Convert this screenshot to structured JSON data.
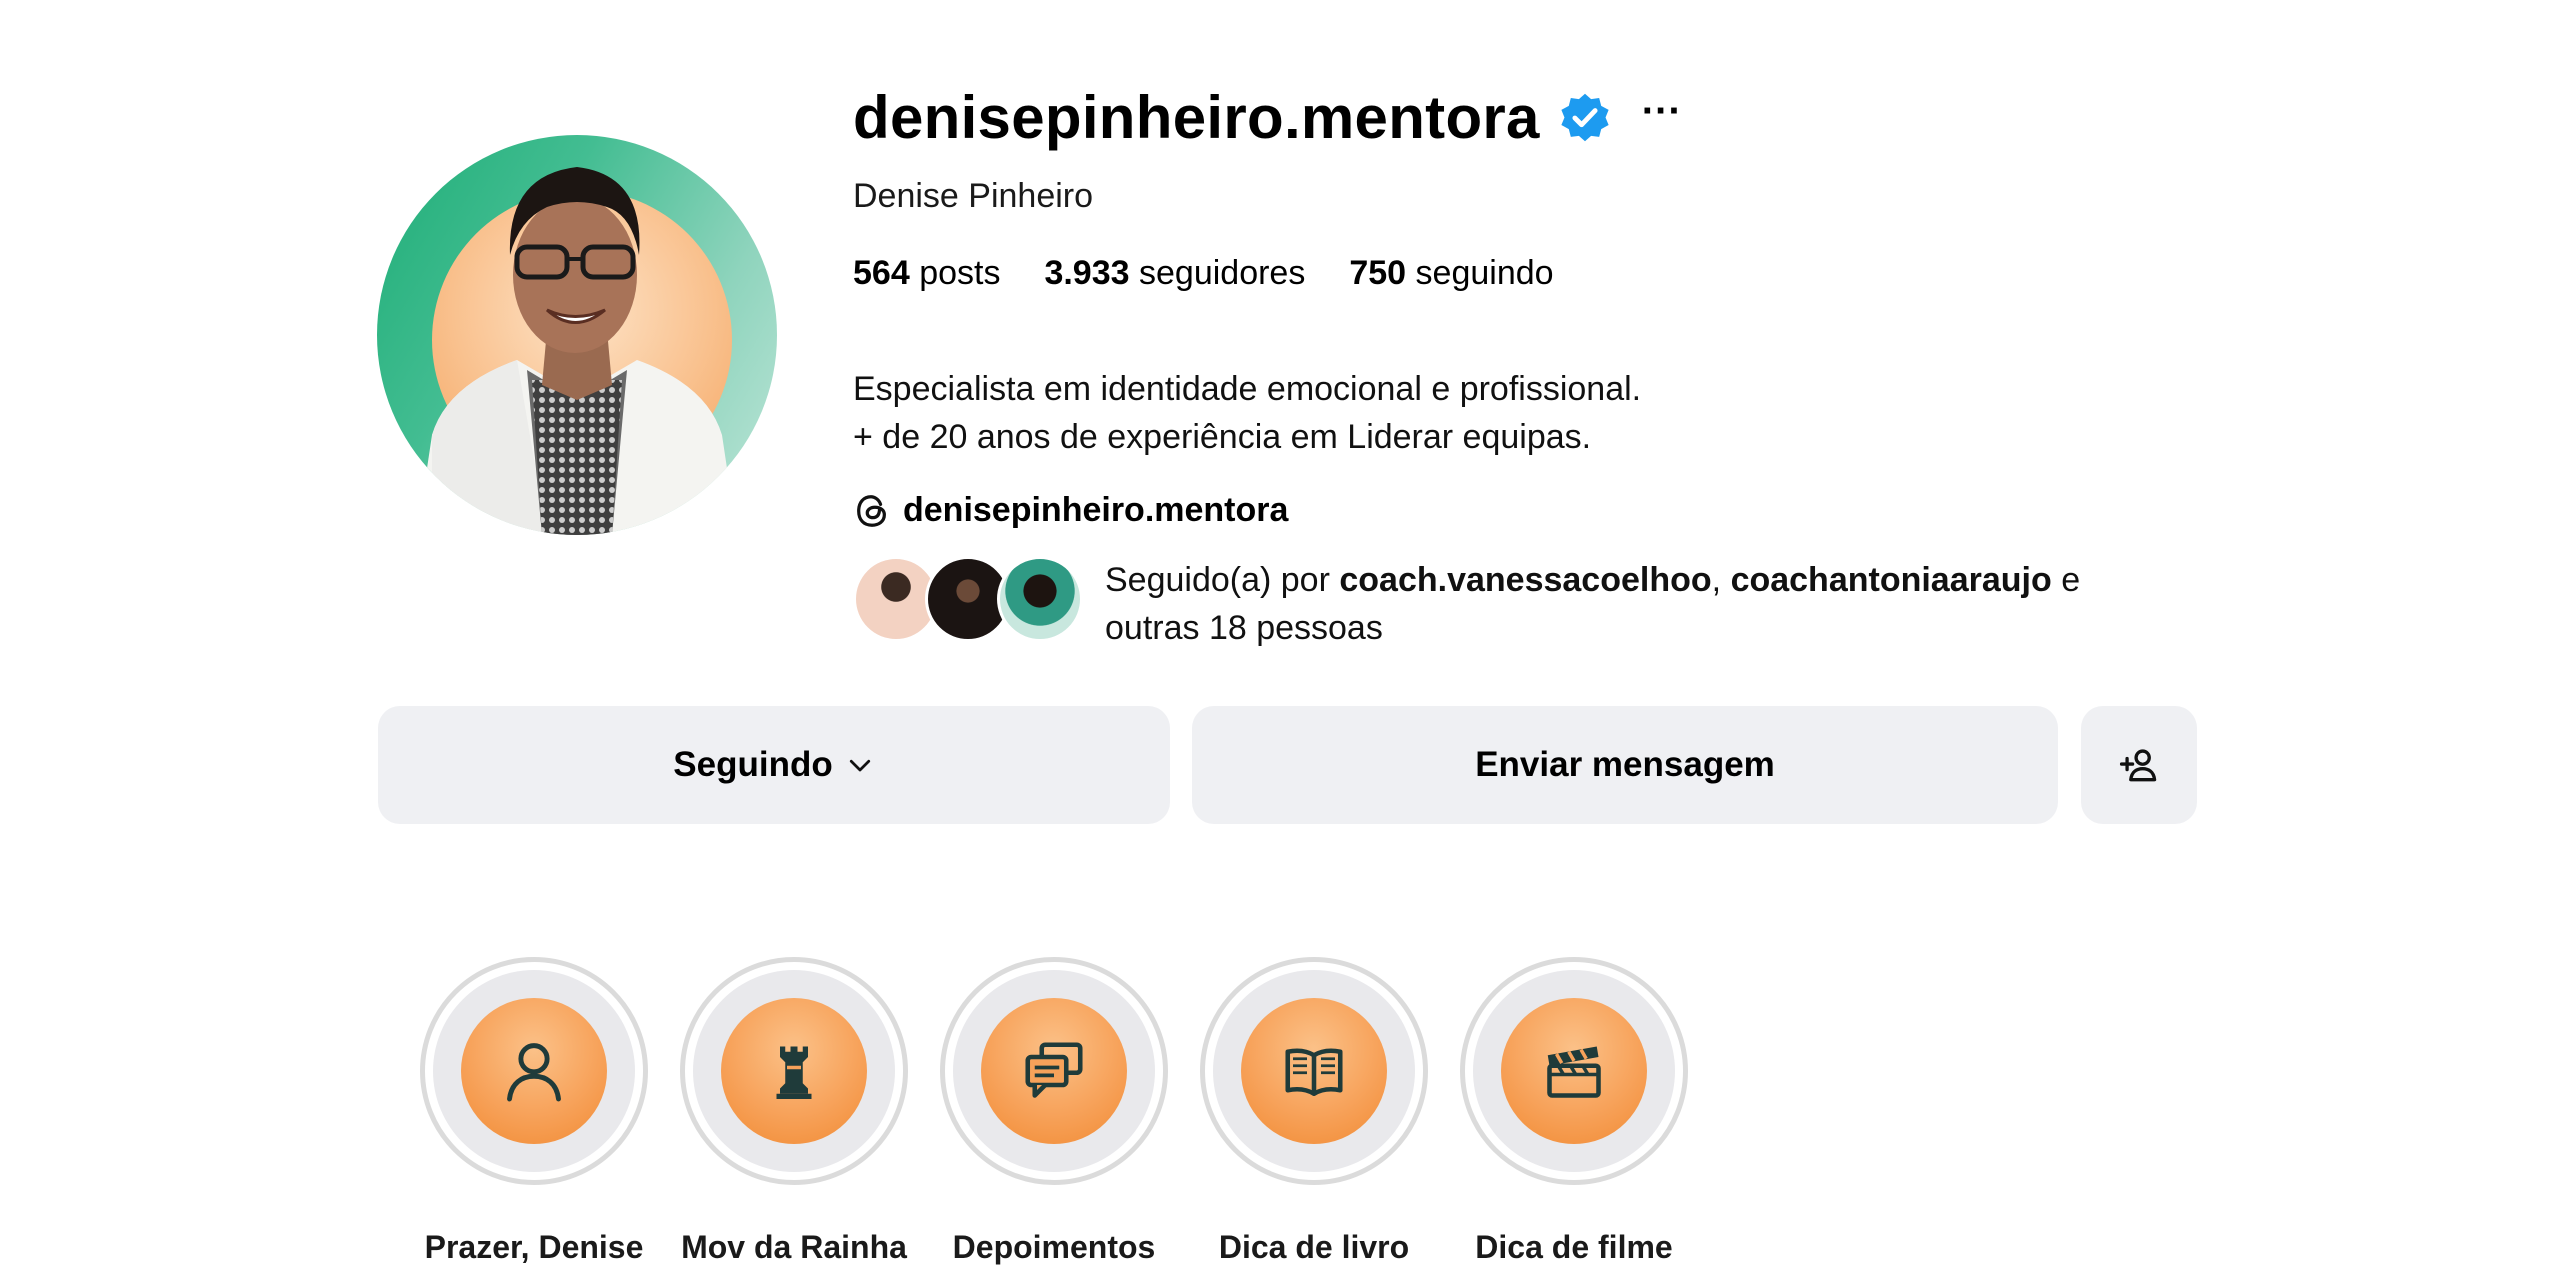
{
  "profile": {
    "username": "denisepinheiro.mentora",
    "verified_icon": "verified-badge-icon",
    "more_label": "···",
    "full_name": "Denise Pinheiro",
    "stats": {
      "posts_count": "564",
      "posts_label": "posts",
      "followers_count": "3.933",
      "followers_label": "seguidores",
      "following_count": "750",
      "following_label": "seguindo"
    },
    "bio": [
      "Especialista em identidade emocional e profissional.",
      "+ de 20 anos de experiência em Liderar equipas."
    ],
    "threads_handle": "denisepinheiro.mentora",
    "followed_by": {
      "prefix": "Seguido(a) por ",
      "user1": "coach.vanessacoelhoo",
      "separator": ", ",
      "user2": "coachantoniaaraujo",
      "suffix": " e",
      "more": "outras 18 pessoas"
    }
  },
  "actions": {
    "following_label": "Seguindo",
    "message_label": "Enviar mensagem",
    "add_user_icon": "add-user-icon"
  },
  "highlights": [
    {
      "label": "Prazer, Denise",
      "icon": "person-icon"
    },
    {
      "label": "Mov da Rainha",
      "icon": "chess-rook-icon"
    },
    {
      "label": "Depoimentos",
      "icon": "chat-bubbles-icon"
    },
    {
      "label": "Dica de livro",
      "icon": "open-book-icon"
    },
    {
      "label": "Dica de filme",
      "icon": "clapperboard-icon"
    }
  ],
  "colors": {
    "verified_blue": "#1d9bf0",
    "button_bg": "#eff0f3",
    "highlight_orange": "#f7a25a",
    "icon_dark": "#1f3b3a"
  }
}
